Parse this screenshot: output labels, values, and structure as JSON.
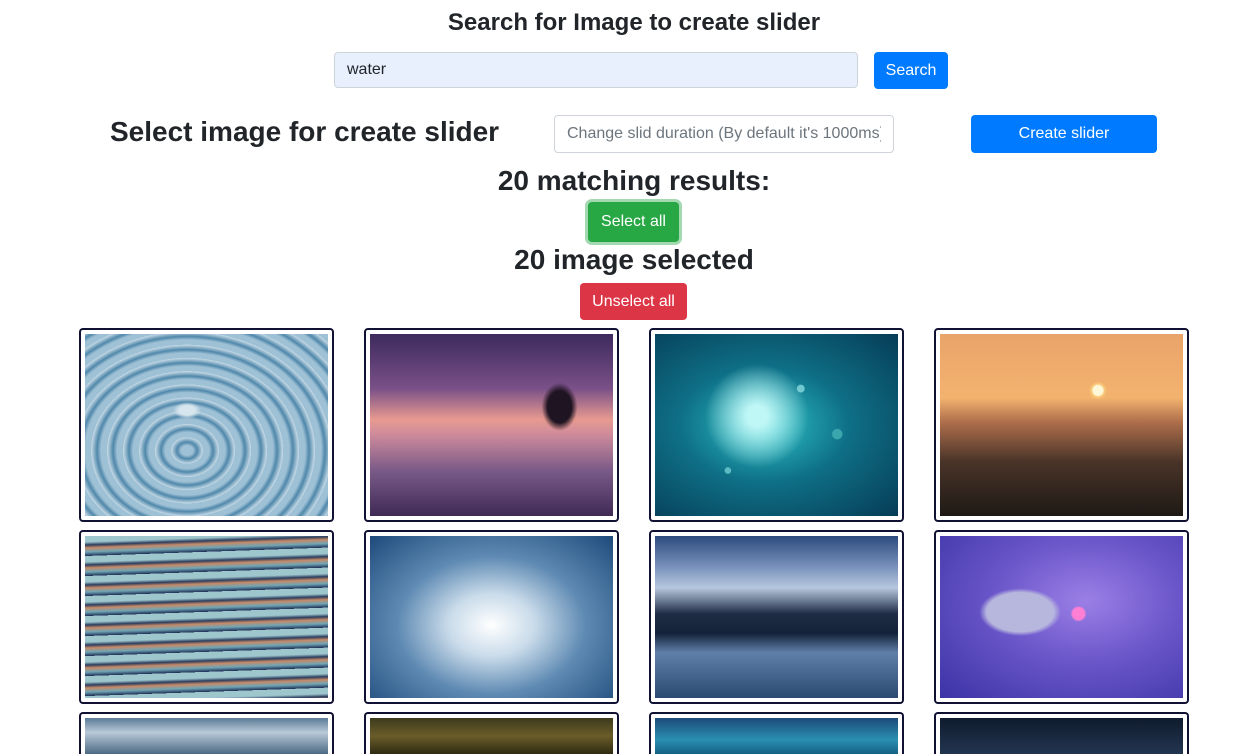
{
  "search": {
    "title": "Search for Image to create slider",
    "query": "water",
    "button_label": "Search"
  },
  "slider": {
    "title": "Select image for create slider",
    "duration_placeholder": "Change slid duration (By default it's 1000ms)",
    "create_label": "Create slider"
  },
  "results": {
    "matching_text": "20 matching results:",
    "select_all_label": "Select all",
    "selected_text": "20 image selected",
    "unselect_all_label": "Unselect all"
  },
  "images": [
    {
      "subject": "water-drop"
    },
    {
      "subject": "sunset-lake-tree"
    },
    {
      "subject": "underwater-bubbles"
    },
    {
      "subject": "ocean-sunset-waves"
    },
    {
      "subject": "water-ripples"
    },
    {
      "subject": "water-splash"
    },
    {
      "subject": "mountain-lake"
    },
    {
      "subject": "water-lily"
    },
    {
      "subject": "sky-clouds"
    },
    {
      "subject": "forest-water"
    },
    {
      "subject": "blue-sea"
    },
    {
      "subject": "night-sky"
    }
  ],
  "colors": {
    "primary": "#007bff",
    "success": "#28a745",
    "danger": "#dc3545",
    "tile_border": "#111133",
    "search_bg": "#e8f0fe"
  }
}
